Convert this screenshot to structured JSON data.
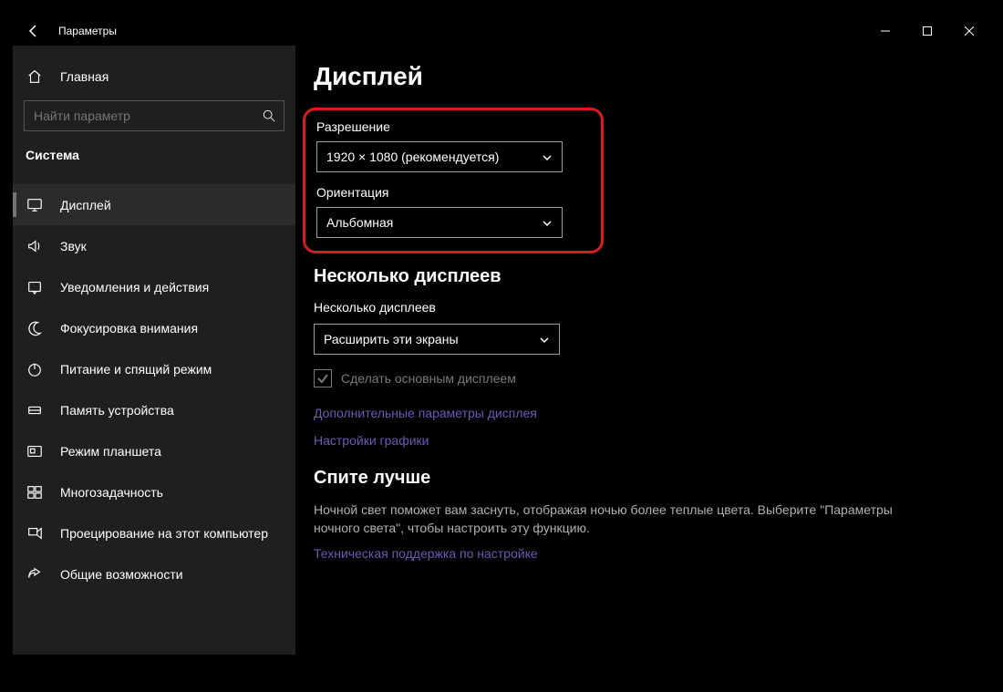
{
  "app_title": "Параметры",
  "home_label": "Главная",
  "search_placeholder": "Найти параметр",
  "section_label": "Система",
  "nav": [
    {
      "label": "Дисплей",
      "icon": "monitor",
      "selected": true
    },
    {
      "label": "Звук",
      "icon": "sound",
      "selected": false
    },
    {
      "label": "Уведомления и действия",
      "icon": "notify",
      "selected": false
    },
    {
      "label": "Фокусировка внимания",
      "icon": "moon",
      "selected": false
    },
    {
      "label": "Питание и спящий режим",
      "icon": "power",
      "selected": false
    },
    {
      "label": "Память устройства",
      "icon": "storage",
      "selected": false
    },
    {
      "label": "Режим планшета",
      "icon": "tablet",
      "selected": false
    },
    {
      "label": "Многозадачность",
      "icon": "multi",
      "selected": false
    },
    {
      "label": "Проецирование на этот компьютер",
      "icon": "project",
      "selected": false
    },
    {
      "label": "Общие возможности",
      "icon": "share",
      "selected": false
    }
  ],
  "page_title": "Дисплей",
  "resolution_label": "Разрешение",
  "resolution_value": "1920 × 1080 (рекомендуется)",
  "orientation_label": "Ориентация",
  "orientation_value": "Альбомная",
  "multi_heading": "Несколько дисплеев",
  "multi_label": "Несколько дисплеев",
  "multi_value": "Расширить эти экраны",
  "make_main_label": "Сделать основным дисплеем",
  "link_advanced": "Дополнительные параметры дисплея",
  "link_graphics": "Настройки графики",
  "sleep_heading": "Спите лучше",
  "sleep_text": "Ночной свет поможет вам заснуть, отображая ночью более теплые цвета. Выберите \"Параметры ночного света\", чтобы настроить эту функцию.",
  "link_support": "Техническая поддержка по настройке"
}
